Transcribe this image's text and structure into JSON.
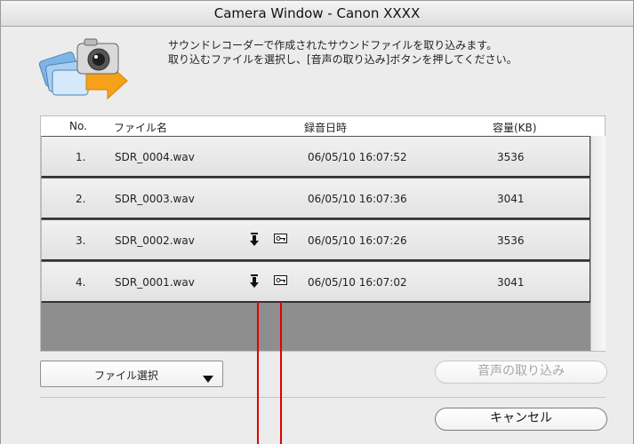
{
  "window": {
    "title": "Camera Window - Canon XXXX"
  },
  "intro": {
    "line1": "サウンドレコーダーで作成されたサウンドファイルを取り込みます。",
    "line2": "取り込むファイルを選択し、[音声の取り込み]ボタンを押してください。",
    "icon": "camera-transfer-icon"
  },
  "table": {
    "columns": {
      "no": "No.",
      "name": "ファイル名",
      "datetime": "録音日時",
      "size": "容量(KB)"
    },
    "rows": [
      {
        "no": "1.",
        "name": "SDR_0004.wav",
        "datetime": "06/05/10 16:07:52",
        "size": "3536",
        "downloaded": false,
        "protected": false
      },
      {
        "no": "2.",
        "name": "SDR_0003.wav",
        "datetime": "06/05/10 16:07:36",
        "size": "3041",
        "downloaded": false,
        "protected": false
      },
      {
        "no": "3.",
        "name": "SDR_0002.wav",
        "datetime": "06/05/10 16:07:26",
        "size": "3536",
        "downloaded": true,
        "protected": true
      },
      {
        "no": "4.",
        "name": "SDR_0001.wav",
        "datetime": "06/05/10 16:07:02",
        "size": "3041",
        "downloaded": true,
        "protected": true
      }
    ]
  },
  "controls": {
    "file_select_label": "ファイル選択",
    "import_label": "音声の取り込み",
    "cancel_label": "キャンセル"
  },
  "colors": {
    "annotation_line": "#e00000",
    "empty_area": "#8e8e8e"
  }
}
